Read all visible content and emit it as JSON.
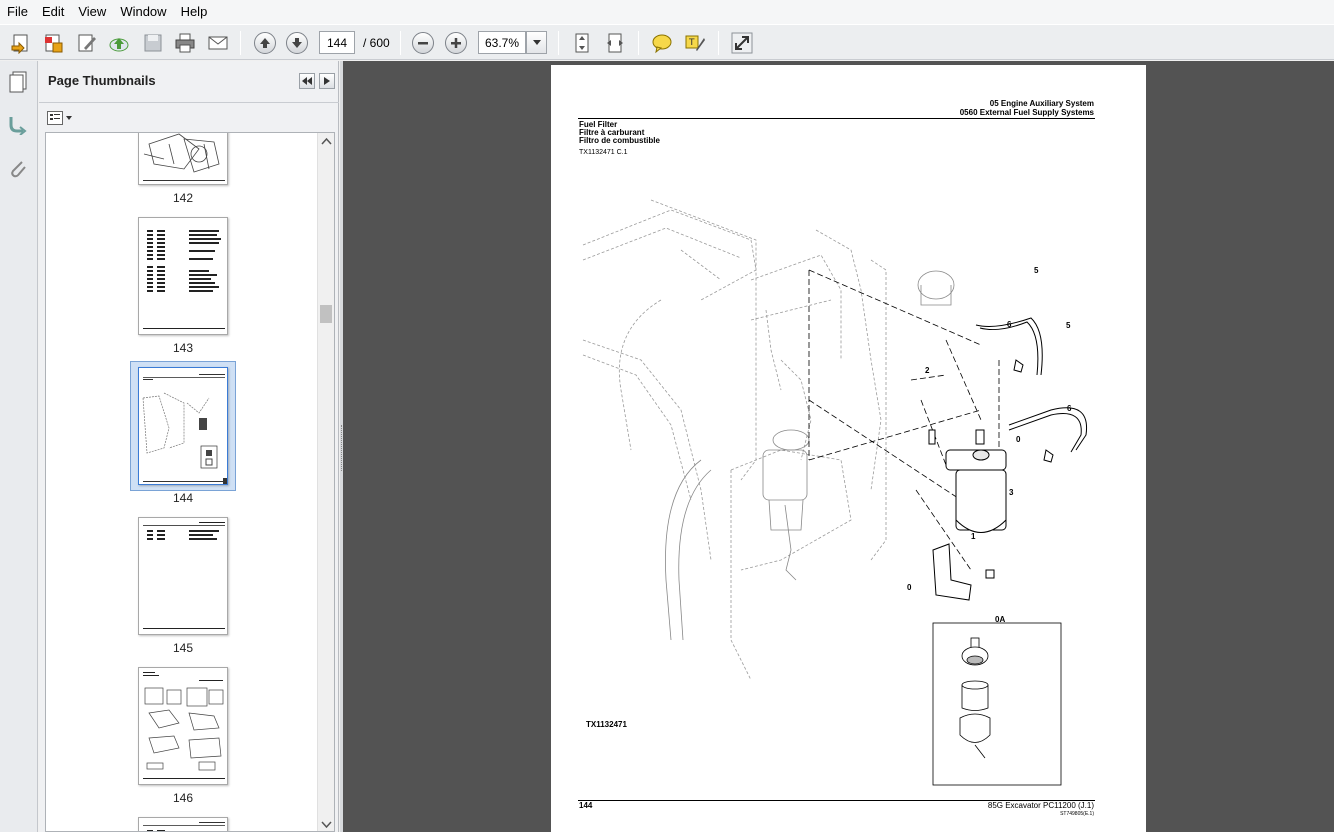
{
  "menu": [
    "File",
    "Edit",
    "View",
    "Window",
    "Help"
  ],
  "toolbar": {
    "page_current": "144",
    "page_total": "/ 600",
    "zoom": "63.7%"
  },
  "icons": {
    "create": "create-pdf-icon",
    "convert": "convert-icon",
    "edit": "edit-icon",
    "upload": "upload-icon",
    "save": "save-icon",
    "print": "print-icon",
    "email": "email-icon",
    "prev": "previous-page-icon",
    "next": "next-page-icon",
    "zoom_out": "zoom-out-icon",
    "zoom_in": "zoom-in-icon",
    "fit_page": "fit-page-icon",
    "fit_width": "fit-width-icon",
    "comment": "comment-icon",
    "highlight": "highlight-icon",
    "expand": "expand-icon"
  },
  "panel": {
    "title": "Page Thumbnails",
    "thumbnails": [
      {
        "label": "142"
      },
      {
        "label": "143"
      },
      {
        "label": "144",
        "selected": true
      },
      {
        "label": "145"
      },
      {
        "label": "146"
      }
    ]
  },
  "page": {
    "header_line1": "05 Engine Auxiliary System",
    "header_line2": "0560 External Fuel Supply Systems",
    "title_en": "Fuel Filter",
    "title_fr": "Filtre à carburant",
    "title_es": "Filtro de combustible",
    "ref_code": "TX1132471 C.1",
    "figure_code": "TX1132471",
    "page_number": "144",
    "footer_model": "85G Excavator   PC11200   (J.1)",
    "footer_small": "ST749805(E.1)",
    "callouts": [
      "5",
      "6",
      "5",
      "2",
      "6",
      "0",
      "3",
      "1",
      "0",
      "0A"
    ]
  },
  "colors": {
    "accent_selected": "#3a7bd5",
    "viewer_bg": "#535353"
  }
}
